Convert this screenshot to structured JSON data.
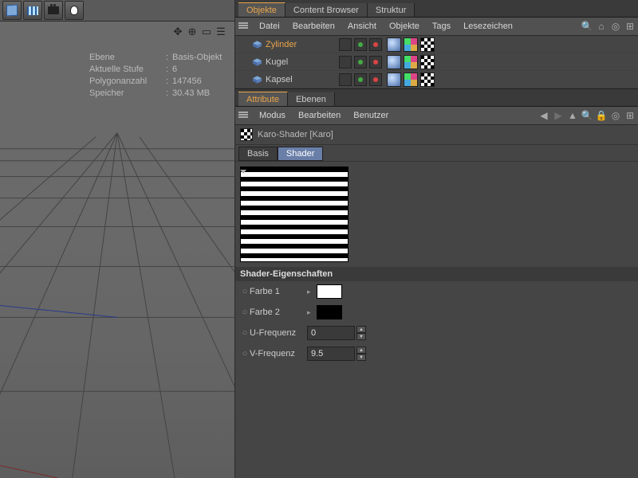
{
  "left_toolbar": {
    "icons": [
      "cube",
      "grid",
      "camera",
      "light"
    ]
  },
  "viewport_overlay": [
    "move-icon",
    "crosshair-icon",
    "fit-icon",
    "menu-icon"
  ],
  "viewport_info": {
    "layer_k": "Ebene",
    "layer_v": "Basis-Objekt",
    "level_k": "Aktuelle Stufe",
    "level_v": "6",
    "poly_k": "Polygonanzahl",
    "poly_v": "147456",
    "mem_k": "Speicher",
    "mem_v": "30.43 MB"
  },
  "obj_tabs": {
    "objekte": "Objekte",
    "content": "Content Browser",
    "struktur": "Struktur"
  },
  "obj_menu": {
    "datei": "Datei",
    "bearbeiten": "Bearbeiten",
    "ansicht": "Ansicht",
    "objekte": "Objekte",
    "tags": "Tags",
    "lesezeichen": "Lesezeichen"
  },
  "objects": [
    {
      "name": "Zylinder",
      "selected": true
    },
    {
      "name": "Kugel",
      "selected": false
    },
    {
      "name": "Kapsel",
      "selected": false
    }
  ],
  "attr_tabs": {
    "attribute": "Attribute",
    "ebenen": "Ebenen"
  },
  "attr_menu": {
    "modus": "Modus",
    "bearbeiten": "Bearbeiten",
    "benutzer": "Benutzer"
  },
  "shader_title": "Karo-Shader [Karo]",
  "subtabs": {
    "basis": "Basis",
    "shader": "Shader"
  },
  "section_head": "Shader-Eigenschaften",
  "props": {
    "farbe1_label": "Farbe 1",
    "farbe1_color": "#ffffff",
    "farbe2_label": "Farbe 2",
    "farbe2_color": "#000000",
    "ufreq_label": "U-Frequenz",
    "ufreq_value": "0",
    "vfreq_label": "V-Frequenz",
    "vfreq_value": "9.5"
  }
}
